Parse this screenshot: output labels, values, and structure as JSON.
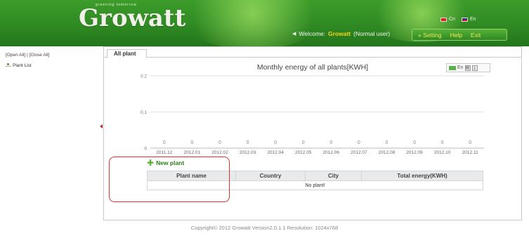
{
  "header": {
    "logo_text": "Growatt",
    "tagline": "greening tomorrow",
    "lang_cn": "Cn",
    "lang_en": "En",
    "welcome_label": "Welcome:",
    "username": "Growatt",
    "user_role": "(Normal user)",
    "menu": [
      {
        "label": "» Setting"
      },
      {
        "label": "Help"
      },
      {
        "label": "Exit"
      }
    ]
  },
  "sidebar": {
    "toggles": "[Open All] | [Close All]",
    "tree_root": "Plant List"
  },
  "tabs": [
    {
      "label": "All plant"
    }
  ],
  "chart_data": {
    "type": "bar",
    "title": "Monthly energy of all plants[KWH]",
    "categories": [
      "2011.12",
      "2012.01",
      "2012.02",
      "2012.03",
      "2012.04",
      "2012.05",
      "2012.06",
      "2012.07",
      "2012.08",
      "2012.09",
      "2012.10",
      "2012.11"
    ],
    "values": [
      0,
      0,
      0,
      0,
      0,
      0,
      0,
      0,
      0,
      0,
      0,
      0
    ],
    "ylim": [
      0,
      0.2
    ],
    "yticks": [
      "0",
      "0.1",
      "0.2"
    ],
    "grid": true,
    "legend_label": "En",
    "legend_position": "top-right",
    "series_color": "#5cb24a"
  },
  "new_plant_label": "New plant",
  "table": {
    "columns": [
      "Plant name",
      "Country",
      "City",
      "Total energy(KWH)"
    ],
    "empty_message": "No plant!"
  },
  "footer": {
    "text": "Copyright© 2012 Growatt Version2.0.1.1 Resolution: 1024x768"
  },
  "colors": {
    "header_green": "#2f8a23",
    "menu_text": "#f7e35b",
    "username": "#f6d21a",
    "highlight_box": "#d9332b"
  }
}
